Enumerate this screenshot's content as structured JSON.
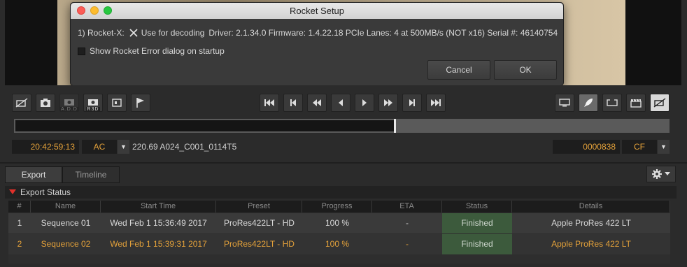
{
  "dialog": {
    "title": "Rocket Setup",
    "device_label": "1) Rocket-X:",
    "use_for_decoding": "Use for decoding",
    "device_info": "Driver: 2.1.34.0 Firmware: 1.4.22.18 PCIe Lanes: 4 at 500MB/s (NOT x16) Serial #: 46140754",
    "show_error_label": "Show Rocket Error dialog on startup",
    "cancel": "Cancel",
    "ok": "OK"
  },
  "toolbar": {
    "left_buttons": [
      "no-video-icon",
      "camera-icon",
      "add-camera-icon",
      "r3d-camera-icon",
      "export-frame-icon",
      "flag-icon"
    ],
    "add_sub": "A.D.D",
    "r3d_sub": "R3D",
    "transport": [
      "skip-to-start-icon",
      "step-start-icon",
      "rewind-icon",
      "play-reverse-icon",
      "play-icon",
      "fast-forward-icon",
      "step-end-icon",
      "skip-to-end-icon"
    ],
    "right_buttons": [
      "monitor-icon",
      "rocket-icon",
      "loop-icon",
      "clapper-icon",
      "no-audio-icon"
    ]
  },
  "playback": {
    "timecode": "20:42:59:13",
    "tc_mode": "AC",
    "clip_name": "220.69 A024_C001_0114T5",
    "frame_number": "0000838",
    "frame_mode": "CF",
    "progress": 0.58
  },
  "tabs": {
    "export": "Export",
    "timeline": "Timeline"
  },
  "export_status": {
    "header": "Export Status",
    "columns": [
      "#",
      "Name",
      "Start Time",
      "Preset",
      "Progress",
      "ETA",
      "Status",
      "Details"
    ],
    "rows": [
      {
        "num": "1",
        "name": "Sequence 01",
        "start": "Wed Feb 1 15:36:49 2017",
        "preset": "ProRes422LT - HD",
        "progress": "100 %",
        "eta": "-",
        "status": "Finished",
        "details": "Apple ProRes 422 LT"
      },
      {
        "num": "2",
        "name": "Sequence 02",
        "start": "Wed Feb 1 15:39:31 2017",
        "preset": "ProRes422LT - HD",
        "progress": "100 %",
        "eta": "-",
        "status": "Finished",
        "details": "Apple ProRes 422 LT"
      }
    ]
  },
  "colors": {
    "accent_orange": "#e3a13a",
    "status_green": "#3c5a3c",
    "collapse_red": "#e0302a"
  }
}
